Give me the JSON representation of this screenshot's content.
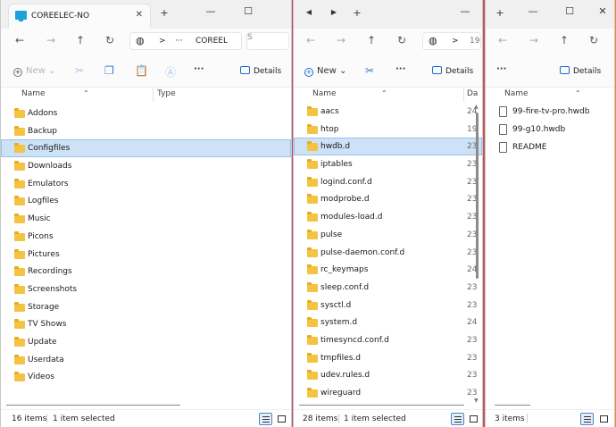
{
  "window1": {
    "tab_title": "COREELEC-NO",
    "close_tab": "✕",
    "new_tab": "+",
    "window_controls": {
      "minimize": "—",
      "maximize": "☐"
    },
    "nav": {
      "back": "←",
      "forward": "→",
      "up": "↑",
      "refresh": "↻"
    },
    "address": {
      "chevron": ">",
      "ellipsis": "···",
      "segment": "COREEL",
      "search_fragment": "S"
    },
    "commands": {
      "new": "New",
      "new_caret": "⌄",
      "more": "···",
      "details": "Details"
    },
    "columns": {
      "name": "Name",
      "type": "Type"
    },
    "items": [
      "Addons",
      "Backup",
      "Configfiles",
      "Downloads",
      "Emulators",
      "Logfiles",
      "Music",
      "Picons",
      "Pictures",
      "Recordings",
      "Screenshots",
      "Storage",
      "TV Shows",
      "Update",
      "Userdata",
      "Videos"
    ],
    "selected_index": 2,
    "status": {
      "count": "16 items",
      "selection": "1 item selected"
    }
  },
  "window2": {
    "tab_left": "◀",
    "tab_right": "▶",
    "new_tab": "+",
    "window_controls": {
      "minimize": "—"
    },
    "nav": {
      "back": "←",
      "forward": "→",
      "up": "↑",
      "refresh": "↻"
    },
    "address": {
      "chevron": ">",
      "segment": "19"
    },
    "commands": {
      "new": "New",
      "new_caret": "⌄",
      "more": "···",
      "details": "Details"
    },
    "columns": {
      "name": "Name",
      "date": "Da"
    },
    "items": [
      {
        "name": "aacs",
        "date": "24"
      },
      {
        "name": "htop",
        "date": "19"
      },
      {
        "name": "hwdb.d",
        "date": "23"
      },
      {
        "name": "iptables",
        "date": "23"
      },
      {
        "name": "logind.conf.d",
        "date": "23"
      },
      {
        "name": "modprobe.d",
        "date": "23"
      },
      {
        "name": "modules-load.d",
        "date": "23"
      },
      {
        "name": "pulse",
        "date": "23"
      },
      {
        "name": "pulse-daemon.conf.d",
        "date": "23"
      },
      {
        "name": "rc_keymaps",
        "date": "24"
      },
      {
        "name": "sleep.conf.d",
        "date": "23"
      },
      {
        "name": "sysctl.d",
        "date": "23"
      },
      {
        "name": "system.d",
        "date": "24"
      },
      {
        "name": "timesyncd.conf.d",
        "date": "23"
      },
      {
        "name": "tmpfiles.d",
        "date": "23"
      },
      {
        "name": "udev.rules.d",
        "date": "23"
      },
      {
        "name": "wireguard",
        "date": "23"
      }
    ],
    "selected_index": 2,
    "status": {
      "count": "28 items",
      "selection": "1 item selected"
    }
  },
  "window3": {
    "new_tab": "+",
    "window_controls": {
      "minimize": "—",
      "maximize": "☐",
      "close": "✕"
    },
    "nav": {
      "back": "←",
      "forward": "→",
      "up": "↑",
      "refresh": "↻"
    },
    "commands": {
      "more": "···",
      "details": "Details"
    },
    "columns": {
      "name": "Name"
    },
    "items": [
      "99-fire-tv-pro.hwdb",
      "99-g10.hwdb",
      "README"
    ],
    "status": {
      "count": "3 items"
    }
  },
  "icons": {
    "folder": "folder-icon",
    "file": "file-icon",
    "cut": "scissors-icon",
    "copy": "copy-icon",
    "paste": "paste-icon",
    "rename": "rename-icon",
    "details": "details-pane-icon",
    "globe": "globe-icon"
  },
  "colors": {
    "accent": "#1a6fc9",
    "folder": "#f5c343",
    "selection": "#cde2f6",
    "selection_border": "#99c2ea"
  }
}
